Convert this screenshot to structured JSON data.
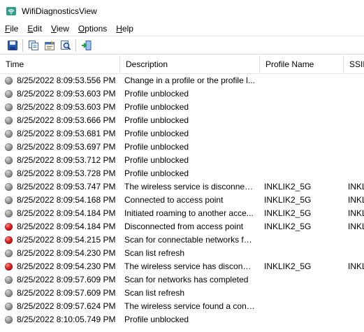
{
  "window": {
    "title": "WifiDiagnosticsView"
  },
  "menu": [
    {
      "label": "File",
      "hotkey": "F",
      "rest": "ile"
    },
    {
      "label": "Edit",
      "hotkey": "E",
      "rest": "dit"
    },
    {
      "label": "View",
      "hotkey": "V",
      "rest": "iew"
    },
    {
      "label": "Options",
      "hotkey": "O",
      "rest": "ptions"
    },
    {
      "label": "Help",
      "hotkey": "H",
      "rest": "elp"
    }
  ],
  "toolbar": {
    "icons": [
      "save-icon",
      "copy-icon",
      "properties-icon",
      "find-icon",
      "exit-icon"
    ]
  },
  "columns": {
    "time": "Time",
    "description": "Description",
    "profile": "Profile Name",
    "ssid": "SSID"
  },
  "rows": [
    {
      "status": "gray",
      "time": "8/25/2022 8:09:53.556 PM",
      "description": "Change in a profile or the profile l...",
      "profile": "",
      "ssid": ""
    },
    {
      "status": "gray",
      "time": "8/25/2022 8:09:53.603 PM",
      "description": "Profile unblocked",
      "profile": "",
      "ssid": ""
    },
    {
      "status": "gray",
      "time": "8/25/2022 8:09:53.603 PM",
      "description": "Profile unblocked",
      "profile": "",
      "ssid": ""
    },
    {
      "status": "gray",
      "time": "8/25/2022 8:09:53.666 PM",
      "description": "Profile unblocked",
      "profile": "",
      "ssid": ""
    },
    {
      "status": "gray",
      "time": "8/25/2022 8:09:53.681 PM",
      "description": "Profile unblocked",
      "profile": "",
      "ssid": ""
    },
    {
      "status": "gray",
      "time": "8/25/2022 8:09:53.697 PM",
      "description": "Profile unblocked",
      "profile": "",
      "ssid": ""
    },
    {
      "status": "gray",
      "time": "8/25/2022 8:09:53.712 PM",
      "description": "Profile unblocked",
      "profile": "",
      "ssid": ""
    },
    {
      "status": "gray",
      "time": "8/25/2022 8:09:53.728 PM",
      "description": "Profile unblocked",
      "profile": "",
      "ssid": ""
    },
    {
      "status": "gray",
      "time": "8/25/2022 8:09:53.747 PM",
      "description": "The wireless service is disconnecti...",
      "profile": "INKLIK2_5G",
      "ssid": "INKL"
    },
    {
      "status": "gray",
      "time": "8/25/2022 8:09:54.168 PM",
      "description": "Connected to access point",
      "profile": "INKLIK2_5G",
      "ssid": "INKL"
    },
    {
      "status": "gray",
      "time": "8/25/2022 8:09:54.184 PM",
      "description": "Initiated roaming to another acce...",
      "profile": "INKLIK2_5G",
      "ssid": "INKL"
    },
    {
      "status": "red",
      "time": "8/25/2022 8:09:54.184 PM",
      "description": "Disconnected from access point",
      "profile": "INKLIK2_5G",
      "ssid": "INKL"
    },
    {
      "status": "red",
      "time": "8/25/2022 8:09:54.215 PM",
      "description": "Scan for connectable networks fai...",
      "profile": "",
      "ssid": ""
    },
    {
      "status": "gray",
      "time": "8/25/2022 8:09:54.230 PM",
      "description": "Scan list refresh",
      "profile": "",
      "ssid": ""
    },
    {
      "status": "red",
      "time": "8/25/2022 8:09:54.230 PM",
      "description": "The wireless service has disconne...",
      "profile": "INKLIK2_5G",
      "ssid": "INKL"
    },
    {
      "status": "gray",
      "time": "8/25/2022 8:09:57.609 PM",
      "description": "Scan for networks has completed",
      "profile": "",
      "ssid": ""
    },
    {
      "status": "gray",
      "time": "8/25/2022 8:09:57.609 PM",
      "description": "Scan list refresh",
      "profile": "",
      "ssid": ""
    },
    {
      "status": "gray",
      "time": "8/25/2022 8:09:57.624 PM",
      "description": "The wireless service found a conn...",
      "profile": "",
      "ssid": ""
    },
    {
      "status": "gray",
      "time": "8/25/2022 8:10:05.749 PM",
      "description": "Profile unblocked",
      "profile": "",
      "ssid": ""
    }
  ]
}
